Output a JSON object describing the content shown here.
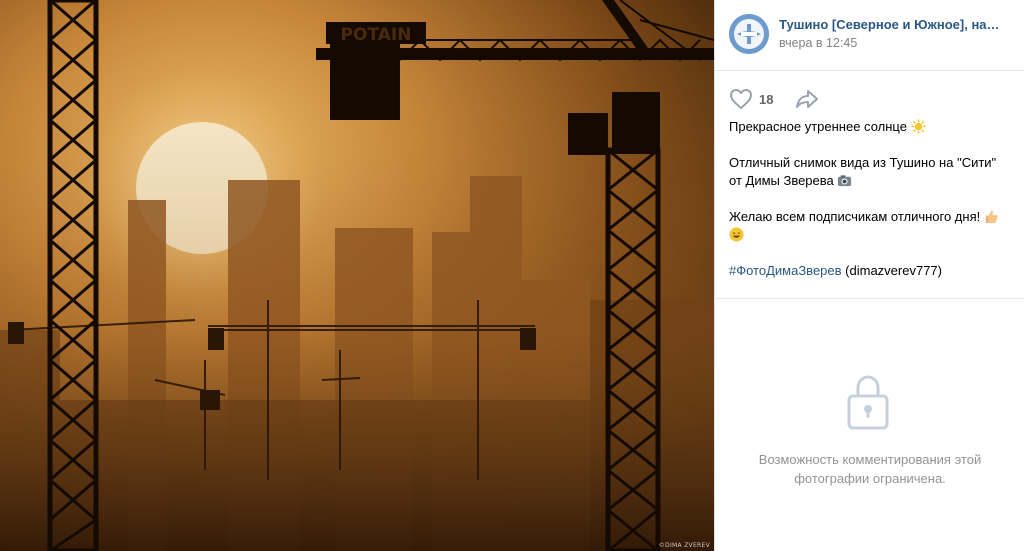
{
  "photo": {
    "alt": "",
    "crane_brand": "POTAIN",
    "watermark": "©DIMA ZVEREV"
  },
  "post": {
    "author": "Тушино [Северное и Южное], наде...",
    "date": "вчера в 12:45",
    "likes": "18",
    "text": {
      "line1": "Прекрасное утреннее солнце",
      "line2": "Отличный снимок вида из Тушино на \"Сити\" от Димы Зверева",
      "line3": "Желаю всем подписчикам отличного дня!",
      "hashtag": "#ФотоДимаЗверев",
      "mention": "(dimazverev777)"
    }
  },
  "comments": {
    "restricted_text": "Возможность комментирования этой фотографии ограничена."
  },
  "colors": {
    "link": "#2a5885",
    "muted": "#828282",
    "icon": "#99a2ad",
    "restricted": "#939393"
  },
  "icons": [
    "heart-icon",
    "share-icon",
    "lock-icon",
    "sun-emoji",
    "camera-emoji",
    "thumbs-up-emoji",
    "smile-emoji"
  ]
}
